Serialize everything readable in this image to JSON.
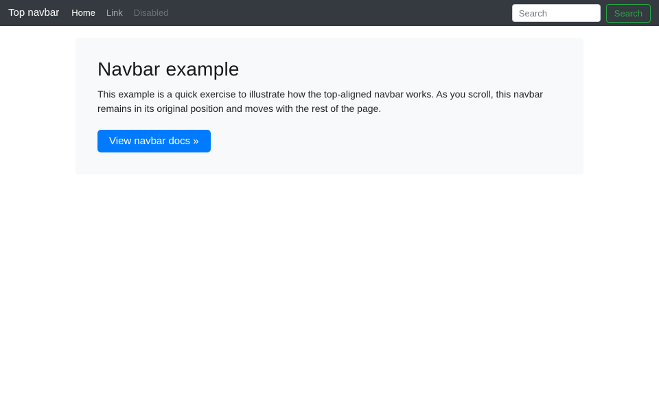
{
  "navbar": {
    "brand": "Top navbar",
    "links": [
      {
        "label": "Home",
        "state": "active"
      },
      {
        "label": "Link",
        "state": "normal"
      },
      {
        "label": "Disabled",
        "state": "disabled"
      }
    ],
    "search": {
      "placeholder": "Search",
      "value": "",
      "button_label": "Search"
    }
  },
  "jumbotron": {
    "title": "Navbar example",
    "body": "This example is a quick exercise to illustrate how the top-aligned navbar works. As you scroll, this navbar remains in its original position and moves with the rest of the page.",
    "cta_label": "View navbar docs »"
  },
  "colors": {
    "navbar_bg": "#343a40",
    "primary": "#007bff",
    "success_outline": "#28a745",
    "jumbotron_bg": "#f8f9fa",
    "text": "#212529"
  }
}
